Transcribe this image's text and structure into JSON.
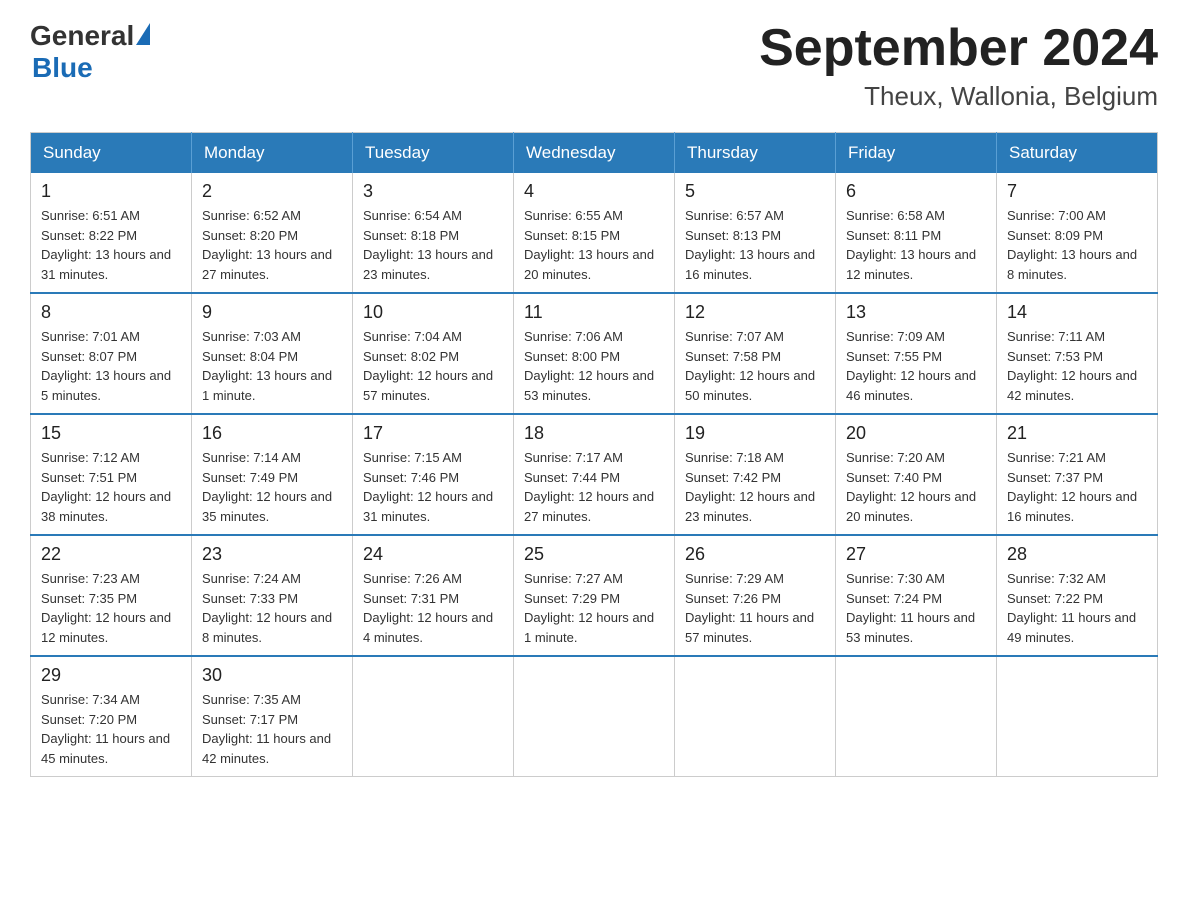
{
  "logo": {
    "general": "General",
    "blue": "Blue"
  },
  "title": {
    "month_year": "September 2024",
    "location": "Theux, Wallonia, Belgium"
  },
  "header": {
    "days": [
      "Sunday",
      "Monday",
      "Tuesday",
      "Wednesday",
      "Thursday",
      "Friday",
      "Saturday"
    ]
  },
  "weeks": [
    [
      {
        "day": "1",
        "sunrise": "6:51 AM",
        "sunset": "8:22 PM",
        "daylight": "13 hours and 31 minutes."
      },
      {
        "day": "2",
        "sunrise": "6:52 AM",
        "sunset": "8:20 PM",
        "daylight": "13 hours and 27 minutes."
      },
      {
        "day": "3",
        "sunrise": "6:54 AM",
        "sunset": "8:18 PM",
        "daylight": "13 hours and 23 minutes."
      },
      {
        "day": "4",
        "sunrise": "6:55 AM",
        "sunset": "8:15 PM",
        "daylight": "13 hours and 20 minutes."
      },
      {
        "day": "5",
        "sunrise": "6:57 AM",
        "sunset": "8:13 PM",
        "daylight": "13 hours and 16 minutes."
      },
      {
        "day": "6",
        "sunrise": "6:58 AM",
        "sunset": "8:11 PM",
        "daylight": "13 hours and 12 minutes."
      },
      {
        "day": "7",
        "sunrise": "7:00 AM",
        "sunset": "8:09 PM",
        "daylight": "13 hours and 8 minutes."
      }
    ],
    [
      {
        "day": "8",
        "sunrise": "7:01 AM",
        "sunset": "8:07 PM",
        "daylight": "13 hours and 5 minutes."
      },
      {
        "day": "9",
        "sunrise": "7:03 AM",
        "sunset": "8:04 PM",
        "daylight": "13 hours and 1 minute."
      },
      {
        "day": "10",
        "sunrise": "7:04 AM",
        "sunset": "8:02 PM",
        "daylight": "12 hours and 57 minutes."
      },
      {
        "day": "11",
        "sunrise": "7:06 AM",
        "sunset": "8:00 PM",
        "daylight": "12 hours and 53 minutes."
      },
      {
        "day": "12",
        "sunrise": "7:07 AM",
        "sunset": "7:58 PM",
        "daylight": "12 hours and 50 minutes."
      },
      {
        "day": "13",
        "sunrise": "7:09 AM",
        "sunset": "7:55 PM",
        "daylight": "12 hours and 46 minutes."
      },
      {
        "day": "14",
        "sunrise": "7:11 AM",
        "sunset": "7:53 PM",
        "daylight": "12 hours and 42 minutes."
      }
    ],
    [
      {
        "day": "15",
        "sunrise": "7:12 AM",
        "sunset": "7:51 PM",
        "daylight": "12 hours and 38 minutes."
      },
      {
        "day": "16",
        "sunrise": "7:14 AM",
        "sunset": "7:49 PM",
        "daylight": "12 hours and 35 minutes."
      },
      {
        "day": "17",
        "sunrise": "7:15 AM",
        "sunset": "7:46 PM",
        "daylight": "12 hours and 31 minutes."
      },
      {
        "day": "18",
        "sunrise": "7:17 AM",
        "sunset": "7:44 PM",
        "daylight": "12 hours and 27 minutes."
      },
      {
        "day": "19",
        "sunrise": "7:18 AM",
        "sunset": "7:42 PM",
        "daylight": "12 hours and 23 minutes."
      },
      {
        "day": "20",
        "sunrise": "7:20 AM",
        "sunset": "7:40 PM",
        "daylight": "12 hours and 20 minutes."
      },
      {
        "day": "21",
        "sunrise": "7:21 AM",
        "sunset": "7:37 PM",
        "daylight": "12 hours and 16 minutes."
      }
    ],
    [
      {
        "day": "22",
        "sunrise": "7:23 AM",
        "sunset": "7:35 PM",
        "daylight": "12 hours and 12 minutes."
      },
      {
        "day": "23",
        "sunrise": "7:24 AM",
        "sunset": "7:33 PM",
        "daylight": "12 hours and 8 minutes."
      },
      {
        "day": "24",
        "sunrise": "7:26 AM",
        "sunset": "7:31 PM",
        "daylight": "12 hours and 4 minutes."
      },
      {
        "day": "25",
        "sunrise": "7:27 AM",
        "sunset": "7:29 PM",
        "daylight": "12 hours and 1 minute."
      },
      {
        "day": "26",
        "sunrise": "7:29 AM",
        "sunset": "7:26 PM",
        "daylight": "11 hours and 57 minutes."
      },
      {
        "day": "27",
        "sunrise": "7:30 AM",
        "sunset": "7:24 PM",
        "daylight": "11 hours and 53 minutes."
      },
      {
        "day": "28",
        "sunrise": "7:32 AM",
        "sunset": "7:22 PM",
        "daylight": "11 hours and 49 minutes."
      }
    ],
    [
      {
        "day": "29",
        "sunrise": "7:34 AM",
        "sunset": "7:20 PM",
        "daylight": "11 hours and 45 minutes."
      },
      {
        "day": "30",
        "sunrise": "7:35 AM",
        "sunset": "7:17 PM",
        "daylight": "11 hours and 42 minutes."
      },
      null,
      null,
      null,
      null,
      null
    ]
  ],
  "labels": {
    "sunrise": "Sunrise:",
    "sunset": "Sunset:",
    "daylight": "Daylight:"
  }
}
